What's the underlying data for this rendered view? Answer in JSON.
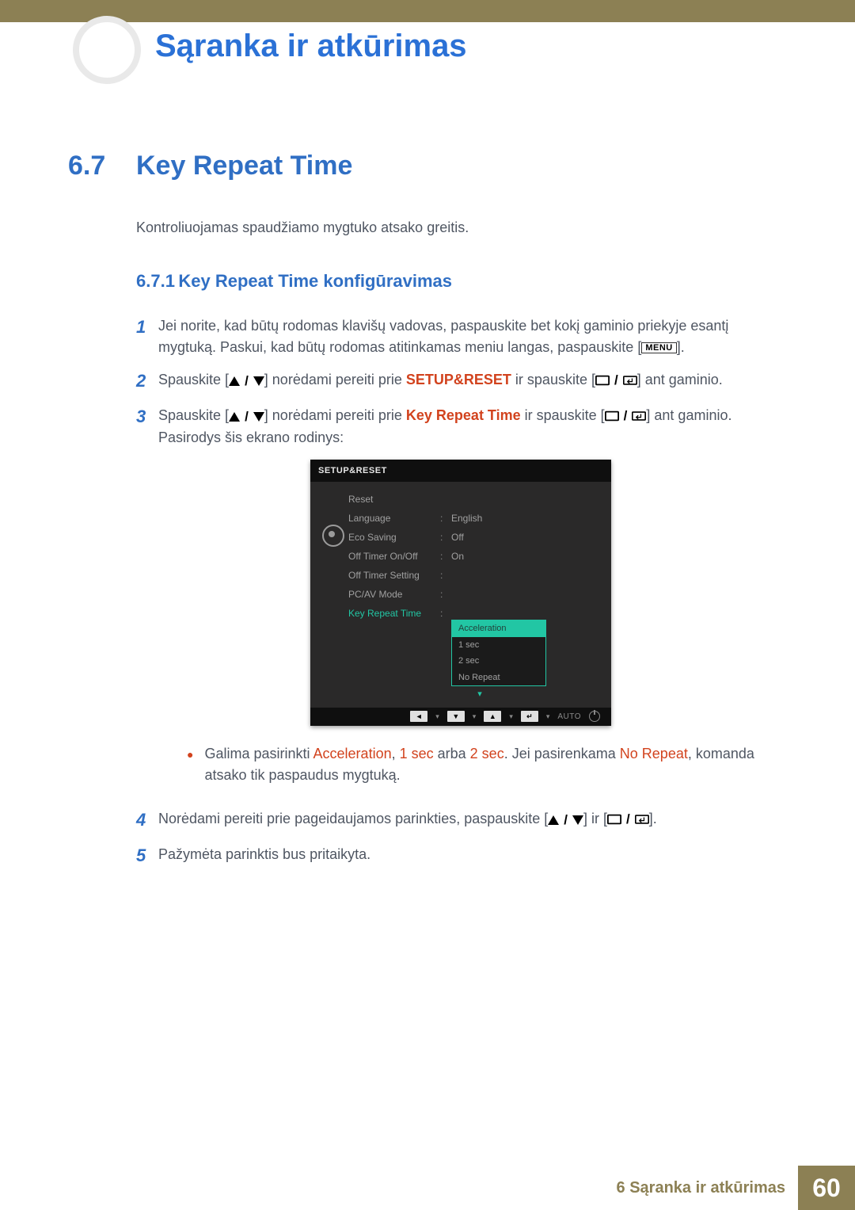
{
  "chapter_title": "Sąranka ir atkūrimas",
  "section": {
    "num": "6.7",
    "title": "Key Repeat Time"
  },
  "intro": "Kontroliuojamas spaudžiamo mygtuko atsako greitis.",
  "subsection": {
    "num": "6.7.1",
    "title": "Key Repeat Time konfigūravimas"
  },
  "steps": {
    "s1": {
      "a": "Jei norite, kad būtų rodomas klavišų vadovas, paspauskite bet kokį gaminio priekyje esantį mygtuką. Paskui, kad būtų rodomas atitinkamas meniu langas, paspauskite [",
      "b": "].",
      "menu_label": "MENU"
    },
    "s2": {
      "a": "Spauskite [",
      "b": "] norėdami pereiti prie ",
      "c": " ir spauskite [",
      "d": "] ant gaminio.",
      "target": "SETUP&RESET"
    },
    "s3": {
      "a": "Spauskite [",
      "b": "] norėdami pereiti prie ",
      "c": " ir spauskite [",
      "d": "] ant gaminio.",
      "target": "Key Repeat Time",
      "tail": "Pasirodys šis ekrano rodinys:"
    },
    "note": {
      "a": "Galima pasirinkti ",
      "b": "Acceleration",
      "c": ", ",
      "d": "1 sec",
      "e": " arba ",
      "f": "2 sec",
      "g": ". Jei pasirenkama ",
      "h": "No Repeat",
      "i": ", komanda atsako tik paspaudus mygtuką."
    },
    "s4": {
      "a": "Norėdami pereiti prie pageidaujamos parinkties, paspauskite [",
      "b": "] ir [",
      "c": "]."
    },
    "s5": {
      "a": "Pažymėta parinktis bus pritaikyta."
    }
  },
  "osd": {
    "header": "SETUP&RESET",
    "rows": [
      {
        "label": "Reset",
        "value": ""
      },
      {
        "label": "Language",
        "value": "English"
      },
      {
        "label": "Eco Saving",
        "value": "Off"
      },
      {
        "label": "Off Timer On/Off",
        "value": "On"
      },
      {
        "label": "Off Timer Setting",
        "value": ""
      },
      {
        "label": "PC/AV Mode",
        "value": ""
      },
      {
        "label": "Key Repeat Time",
        "value": ""
      }
    ],
    "dropdown": [
      "Acceleration",
      "1 sec",
      "2 sec",
      "No Repeat"
    ],
    "dropdown_selected": "Acceleration",
    "footer_auto": "AUTO"
  },
  "footer": {
    "text": "6 Sąranka ir atkūrimas",
    "page": "60"
  }
}
